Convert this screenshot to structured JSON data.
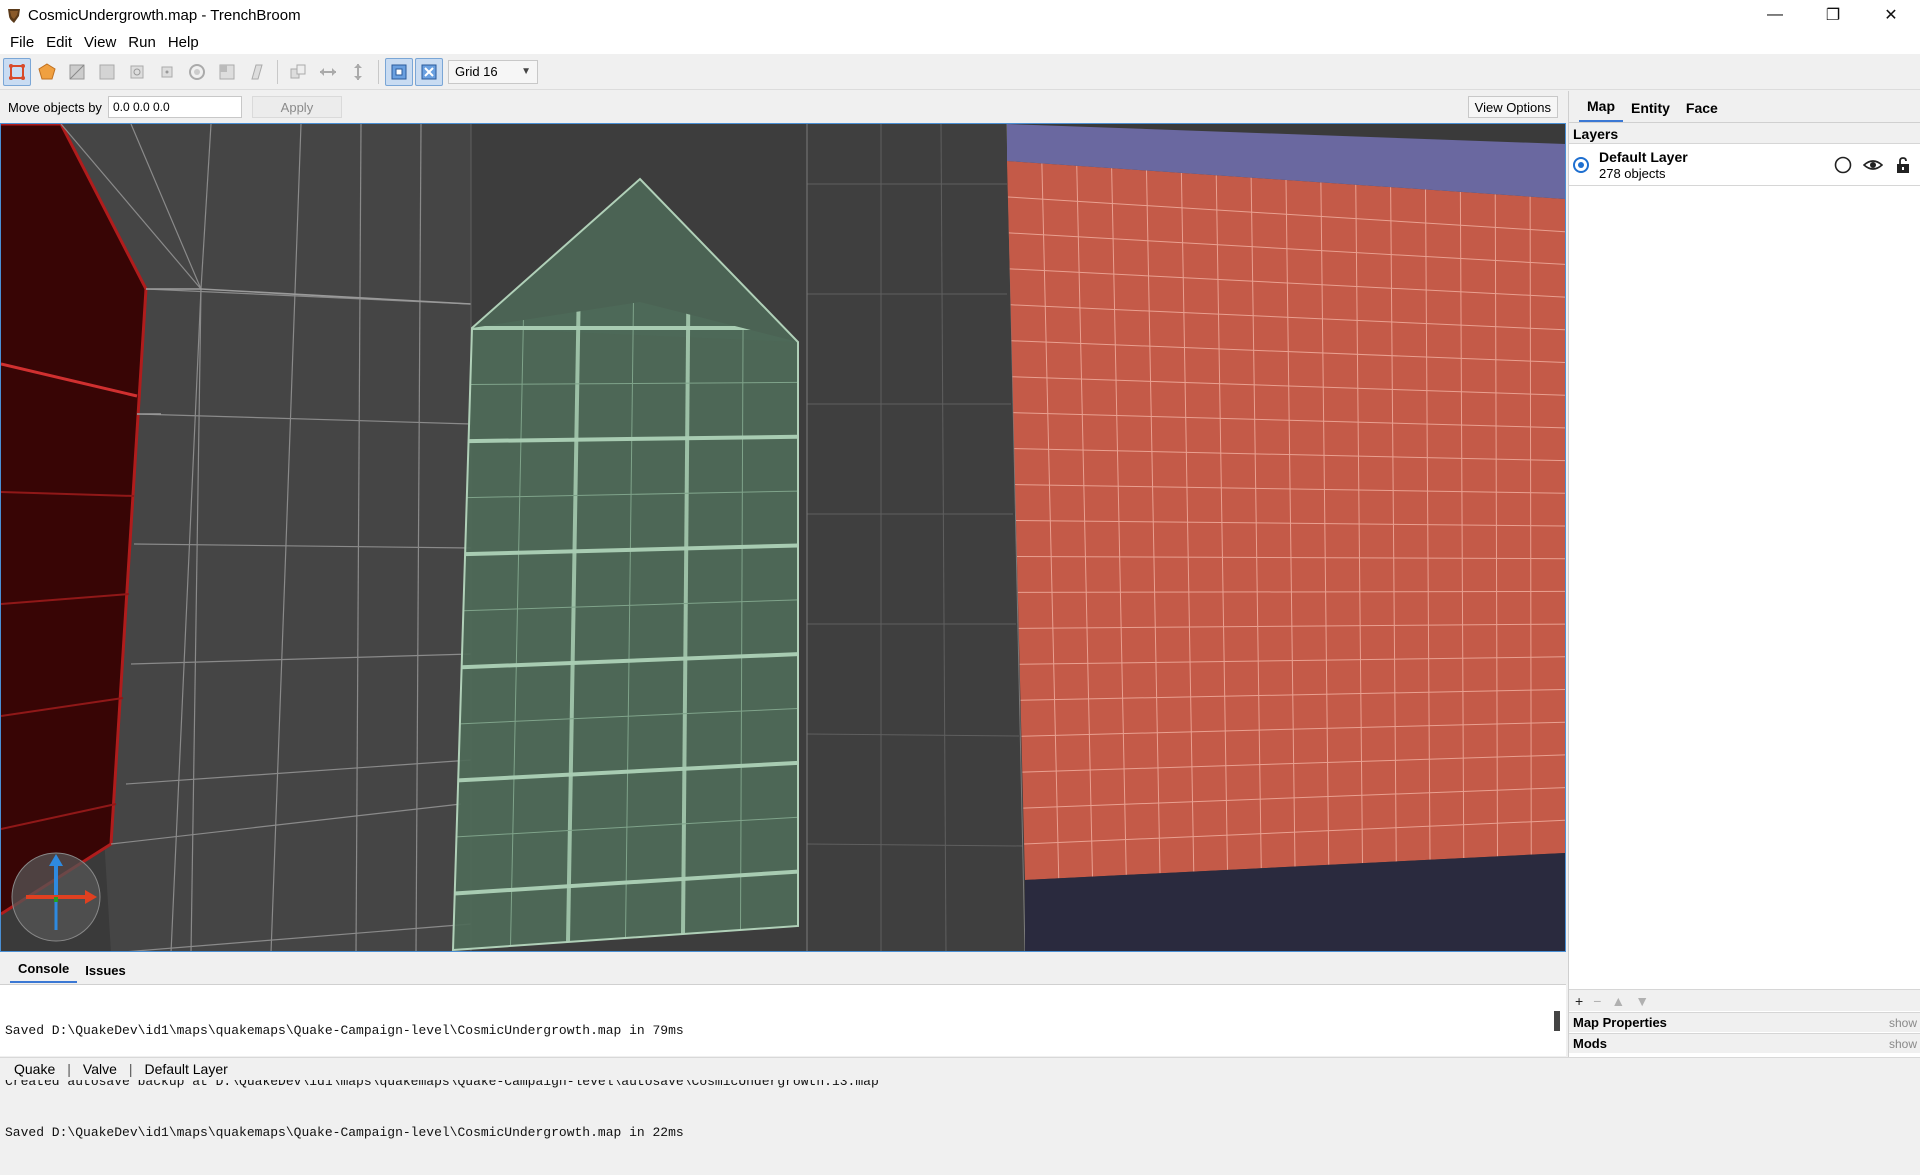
{
  "window": {
    "title": "CosmicUndergrowth.map - TrenchBroom",
    "minimize": "—",
    "restore": "❐",
    "close": "✕"
  },
  "menu": [
    "File",
    "Edit",
    "View",
    "Run",
    "Help"
  ],
  "toolbar": {
    "tools": [
      "clip-tool-icon",
      "vertex-tool-icon",
      "edge-tool-icon",
      "face-tool-icon",
      "rotate-tool-icon",
      "scale-tool-icon",
      "shear-tool-icon",
      "flip-tool-icon",
      "duplicate-icon",
      "flip-horizontal-icon",
      "flip-vertical-icon",
      "texture-lock-icon",
      "uv-lock-icon"
    ],
    "grid_label": "Grid 16"
  },
  "movebar": {
    "label": "Move objects by",
    "value": "0.0 0.0 0.0",
    "apply": "Apply",
    "view_options": "View Options"
  },
  "console": {
    "tabs": [
      "Console",
      "Issues"
    ],
    "lines": [
      "Saved D:\\QuakeDev\\id1\\maps\\quakemaps\\Quake-Campaign-level\\CosmicUndergrowth.map in 79ms",
      "Created autosave backup at D:\\QuakeDev\\id1\\maps\\quakemaps\\Quake-Campaign-level\\autosave\\CosmicUndergrowth.13.map",
      "Saved D:\\QuakeDev\\id1\\maps\\quakemaps\\Quake-Campaign-level\\CosmicUndergrowth.map in 22ms"
    ]
  },
  "status": {
    "game": "Quake",
    "format": "Valve",
    "layer": "Default Layer"
  },
  "inspector": {
    "tabs": [
      "Map",
      "Entity",
      "Face"
    ],
    "layers_title": "Layers",
    "layer": {
      "name": "Default Layer",
      "count": "278 objects"
    },
    "actions": [
      "+",
      "−",
      "▲",
      "▼"
    ],
    "map_properties": "Map Properties",
    "mods": "Mods",
    "show": "show"
  },
  "colors": {
    "accent": "#3b78d4",
    "selection_green": "#4e6a58",
    "red_wall": "#c45a48",
    "dark_red": "#3a0606"
  }
}
